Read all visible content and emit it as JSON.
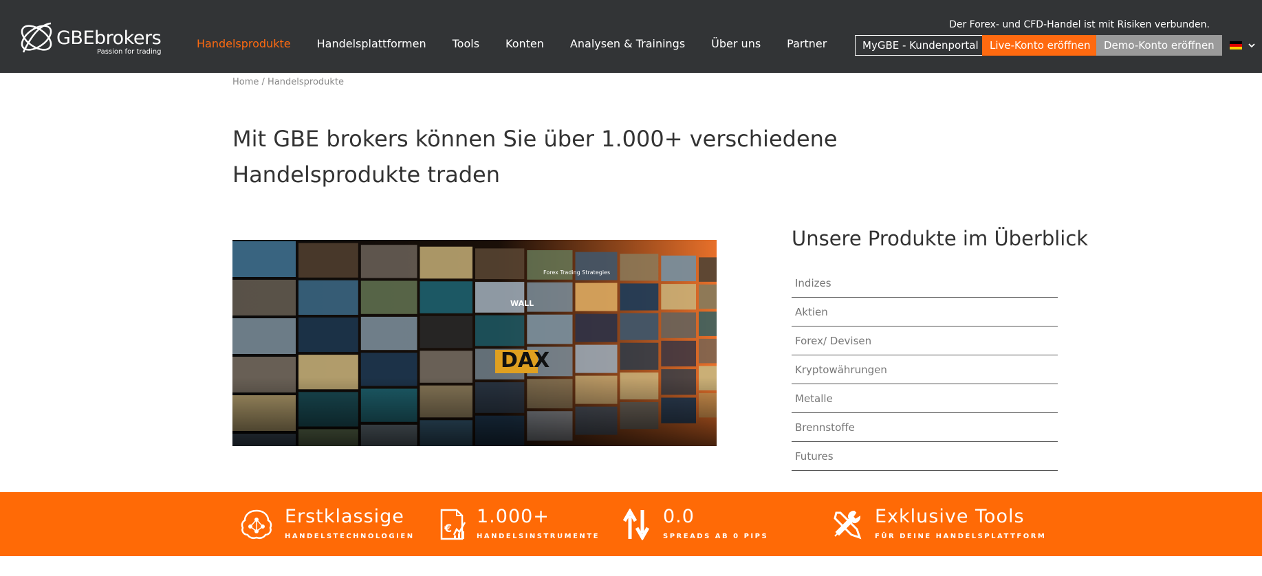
{
  "header": {
    "logo_text_gbe": "GBE",
    "logo_text_brokers": "brokers",
    "logo_tagline": "Passion for trading",
    "risk_notice": "Der Forex- und CFD-Handel ist mit Risiken verbunden.",
    "nav": [
      {
        "label": "Handelsprodukte",
        "active": true
      },
      {
        "label": "Handelsplattformen",
        "active": false
      },
      {
        "label": "Tools",
        "active": false
      },
      {
        "label": "Konten",
        "active": false
      },
      {
        "label": "Analysen & Trainings",
        "active": false
      },
      {
        "label": "Über uns",
        "active": false
      },
      {
        "label": "Partner",
        "active": false
      }
    ],
    "portal_button": "MyGBE - Kundenportal",
    "live_button": "Live-Konto eröffnen",
    "demo_button": "Demo-Konto eröffnen",
    "language_icon": "german-flag-icon"
  },
  "breadcrumb": {
    "home": "Home",
    "separator": " / ",
    "current": "Handelsprodukte"
  },
  "page_title": "Mit GBE brokers können Sie über 1.000+ verschiedene Handelsprodukte traden",
  "products": {
    "title": "Unsere Produkte im Überblick",
    "items": [
      "Indizes",
      "Aktien",
      "Forex/ Devisen",
      "Kryptowährungen",
      "Metalle",
      "Brennstoffe",
      "Futures"
    ]
  },
  "features": [
    {
      "big": "Erstklassige",
      "small": "HANDELSTECHNOLOGIEN",
      "icon": "brain-network-icon"
    },
    {
      "big": "1.000+",
      "small": "HANDELSINSTRUMENTE",
      "icon": "euro-chart-document-icon"
    },
    {
      "big": "0.0",
      "small": "SPREADS AB 0 PIPS",
      "icon": "up-down-arrows-icon"
    },
    {
      "big": "Exklusive Tools",
      "small": "FÜR DEINE HANDELSPLATTFORM",
      "icon": "wrench-screwdriver-icon"
    }
  ],
  "hero_labels": {
    "dax": "DAX",
    "forex_screen": "Forex Trading Strategies",
    "wall": "WALL"
  },
  "colors": {
    "header_bg": "#323436",
    "accent": "#ff6a10",
    "band": "#ff6a06"
  }
}
